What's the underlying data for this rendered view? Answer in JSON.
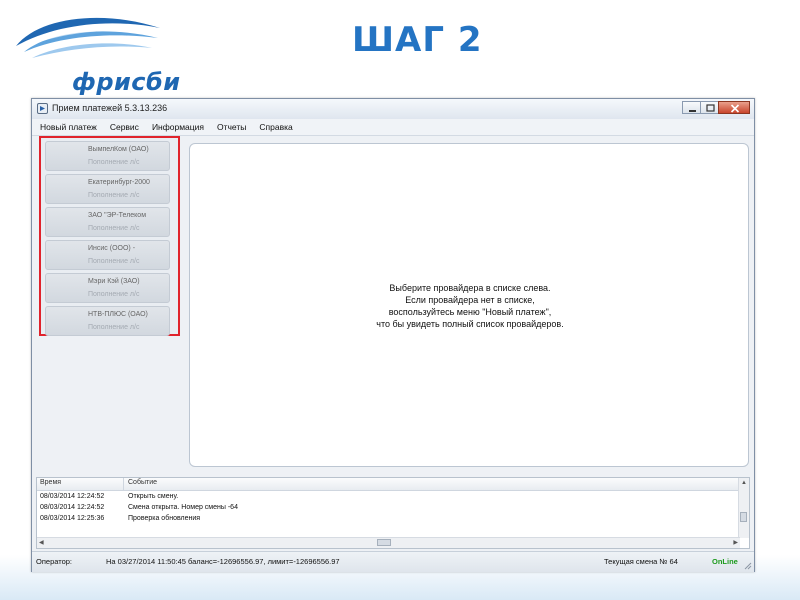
{
  "slide": {
    "title": "ШАГ 2",
    "logo_text": "фрисби",
    "logo_icon": "frisbee-swoosh-logo",
    "accent_color": "#2474c3"
  },
  "window": {
    "title": "Прием платежей 5.3.13.236",
    "app_icon": "app-icon"
  },
  "menu": [
    "Новый платеж",
    "Сервис",
    "Информация",
    "Отчеты",
    "Справка"
  ],
  "providers": [
    {
      "name": "ВымпелКом (ОАО)",
      "subtitle": "Пополнение л/с"
    },
    {
      "name": "Екатеринбург-2000",
      "subtitle": "Пополнение л/с"
    },
    {
      "name": "ЗАО \"ЭР-Телеком",
      "subtitle": "Пополнение л/с"
    },
    {
      "name": "Инсис (ООО) -",
      "subtitle": "Пополнение л/с"
    },
    {
      "name": "Мэри Кэй (ЗАО)",
      "subtitle": "Пополнение л/с"
    },
    {
      "name": "НТВ-ПЛЮС (ОАО)",
      "subtitle": "Пополнение л/с"
    }
  ],
  "highlight_color": "#e0232c",
  "main_hint": [
    "Выберите провайдера в списке слева.",
    "Если провайдера нет в списке,",
    "воспользуйтесь меню \"Новый платеж\",",
    "что бы увидеть полный список провайдеров."
  ],
  "log": {
    "columns": [
      "Время",
      "Событие"
    ],
    "rows": [
      {
        "time": "08/03/2014 12:24:52",
        "event": "Открыть смену."
      },
      {
        "time": "08/03/2014 12:24:52",
        "event": "Смена открыта. Номер смены -64"
      },
      {
        "time": "08/03/2014 12:25:36",
        "event": "Проверка обновления"
      }
    ]
  },
  "status": {
    "operator_label": "Оператор:",
    "balance_text": "На 03/27/2014 11:50:45 баланс=-12696556.97, лимит=-12696556.97",
    "shift_text": "Текущая смена № 64",
    "online_text": "OnLine",
    "online_color": "#1d9a1d"
  }
}
